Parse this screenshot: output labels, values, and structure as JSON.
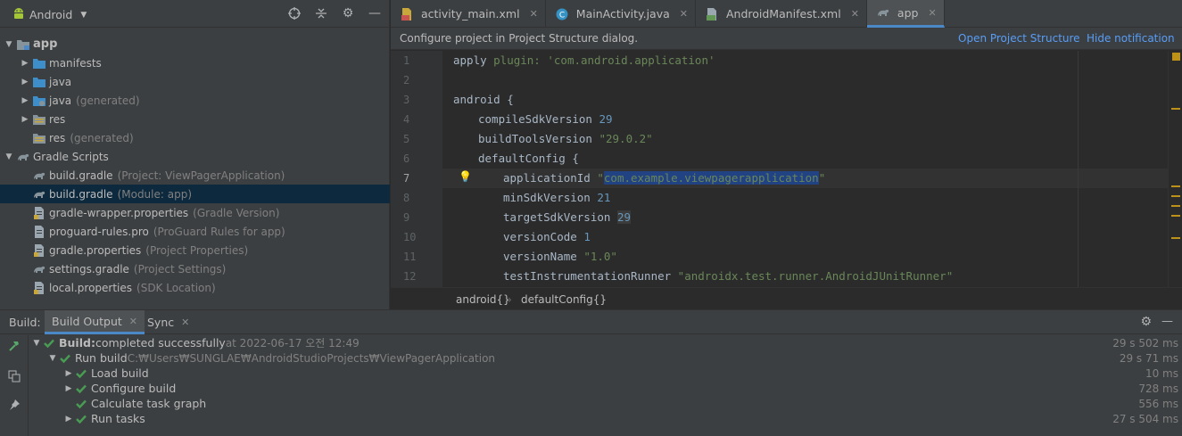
{
  "project_panel": {
    "view_selector": "Android",
    "tree": [
      {
        "label": "app",
        "hint": "",
        "icon": "module-folder-icon",
        "arrow": "▼",
        "indent": 0,
        "bold": true
      },
      {
        "label": "manifests",
        "hint": "",
        "icon": "folder-icon",
        "arrow": "▶",
        "indent": 1
      },
      {
        "label": "java",
        "hint": "",
        "icon": "folder-icon",
        "arrow": "▶",
        "indent": 1
      },
      {
        "label": "java",
        "hint": "(generated)",
        "icon": "generated-folder-icon",
        "arrow": "▶",
        "indent": 1
      },
      {
        "label": "res",
        "hint": "",
        "icon": "res-folder-icon",
        "arrow": "▶",
        "indent": 1
      },
      {
        "label": "res",
        "hint": "(generated)",
        "icon": "res-folder-icon",
        "arrow": "",
        "indent": 1
      },
      {
        "label": "Gradle Scripts",
        "hint": "",
        "icon": "gradle-icon",
        "arrow": "▼",
        "indent": 0
      },
      {
        "label": "build.gradle",
        "hint": "(Project: ViewPagerApplication)",
        "icon": "gradle-icon",
        "arrow": "",
        "indent": 1
      },
      {
        "label": "build.gradle",
        "hint": "(Module: app)",
        "icon": "gradle-icon",
        "arrow": "",
        "indent": 1,
        "selected": true
      },
      {
        "label": "gradle-wrapper.properties",
        "hint": "(Gradle Version)",
        "icon": "properties-icon",
        "arrow": "",
        "indent": 1
      },
      {
        "label": "proguard-rules.pro",
        "hint": "(ProGuard Rules for app)",
        "icon": "file-icon",
        "arrow": "",
        "indent": 1
      },
      {
        "label": "gradle.properties",
        "hint": "(Project Properties)",
        "icon": "properties-icon",
        "arrow": "",
        "indent": 1
      },
      {
        "label": "settings.gradle",
        "hint": "(Project Settings)",
        "icon": "gradle-icon",
        "arrow": "",
        "indent": 1
      },
      {
        "label": "local.properties",
        "hint": "(SDK Location)",
        "icon": "properties-icon",
        "arrow": "",
        "indent": 1
      }
    ]
  },
  "editor_tabs": [
    {
      "label": "activity_main.xml",
      "icon": "xml-layout-icon",
      "active": false
    },
    {
      "label": "MainActivity.java",
      "icon": "java-class-icon",
      "active": false
    },
    {
      "label": "AndroidManifest.xml",
      "icon": "manifest-icon",
      "active": false
    },
    {
      "label": "app",
      "icon": "gradle-icon",
      "active": true
    }
  ],
  "notification": {
    "message": "Configure project in Project Structure dialog.",
    "link_open": "Open Project Structure",
    "link_hide": "Hide notification"
  },
  "code": {
    "current_line": 7,
    "lines": [
      {
        "n": "1",
        "indent": 0,
        "parts": [
          [
            "t",
            "apply "
          ],
          [
            "s",
            "plugin: 'com.android.application'"
          ]
        ]
      },
      {
        "n": "2",
        "indent": 0,
        "parts": []
      },
      {
        "n": "3",
        "indent": 0,
        "parts": [
          [
            "t",
            "android {"
          ]
        ]
      },
      {
        "n": "4",
        "indent": 1,
        "parts": [
          [
            "t",
            "compileSdkVersion "
          ],
          [
            "n",
            "29"
          ]
        ]
      },
      {
        "n": "5",
        "indent": 1,
        "parts": [
          [
            "t",
            "buildToolsVersion "
          ],
          [
            "s",
            "\"29.0.2\""
          ]
        ]
      },
      {
        "n": "6",
        "indent": 1,
        "parts": [
          [
            "t",
            "defaultConfig {"
          ]
        ]
      },
      {
        "n": "7",
        "indent": 2,
        "parts": [
          [
            "t",
            "applicationId "
          ],
          [
            "s",
            "\""
          ],
          [
            "sel",
            "com.example.viewpagerapplication"
          ],
          [
            "s",
            "\""
          ]
        ]
      },
      {
        "n": "8",
        "indent": 2,
        "parts": [
          [
            "t",
            "minSdkVersion "
          ],
          [
            "n",
            "21"
          ]
        ]
      },
      {
        "n": "9",
        "indent": 2,
        "parts": [
          [
            "t",
            "targetSdkVersion "
          ],
          [
            "nh",
            "29"
          ]
        ]
      },
      {
        "n": "10",
        "indent": 2,
        "parts": [
          [
            "t",
            "versionCode "
          ],
          [
            "n",
            "1"
          ]
        ]
      },
      {
        "n": "11",
        "indent": 2,
        "parts": [
          [
            "t",
            "versionName "
          ],
          [
            "s",
            "\"1.0\""
          ]
        ]
      },
      {
        "n": "12",
        "indent": 2,
        "parts": [
          [
            "t",
            "testInstrumentationRunner "
          ],
          [
            "s",
            "\"androidx.test.runner.AndroidJUnitRunner\""
          ]
        ]
      }
    ]
  },
  "breadcrumb": [
    "android{}",
    "defaultConfig{}"
  ],
  "build_panel": {
    "label": "Build:",
    "tabs": [
      {
        "label": "Build Output",
        "active": true
      },
      {
        "label": "Sync",
        "active": false
      }
    ],
    "rows": [
      {
        "arrow": "▼",
        "indent": 0,
        "bold_text": "Build:",
        "text": " completed successfully",
        "detail": " at 2022-06-17 오전 12:49",
        "time": "29 s 502 ms"
      },
      {
        "arrow": "▼",
        "indent": 1,
        "bold_text": "",
        "text": "Run build",
        "detail": " C:₩Users₩SUNGLAE₩AndroidStudioProjects₩ViewPagerApplication",
        "time": "29 s 71 ms"
      },
      {
        "arrow": "▶",
        "indent": 2,
        "bold_text": "",
        "text": "Load build",
        "detail": "",
        "time": "10 ms"
      },
      {
        "arrow": "▶",
        "indent": 2,
        "bold_text": "",
        "text": "Configure build",
        "detail": "",
        "time": "728 ms"
      },
      {
        "arrow": "",
        "indent": 2,
        "bold_text": "",
        "text": "Calculate task graph",
        "detail": "",
        "time": "556 ms"
      },
      {
        "arrow": "▶",
        "indent": 2,
        "bold_text": "",
        "text": "Run tasks",
        "detail": "",
        "time": "27 s 504 ms"
      }
    ]
  },
  "colors": {
    "selection": "#0d293e",
    "link": "#589df6",
    "success": "#499c54",
    "string": "#6a8759",
    "number": "#6897bb"
  }
}
